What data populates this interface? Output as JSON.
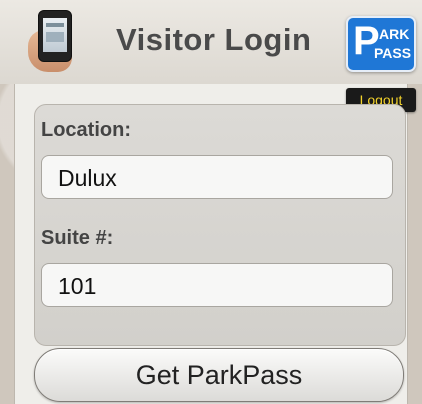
{
  "header": {
    "title": "Visitor Login",
    "logo": {
      "letter": "P",
      "line1": "ARK",
      "line2": "PASS",
      "color": "#1f77d6"
    },
    "phone_icon": "phone-in-hand-icon"
  },
  "logout_label": "Logout",
  "form": {
    "location_label": "Location:",
    "location_value": "Dulux",
    "suite_label": "Suite #:",
    "suite_value": "101"
  },
  "submit_label": "Get ParkPass",
  "colors": {
    "logout_bg": "#1a1a1a",
    "logout_text": "#f3d22b",
    "brand_blue": "#1f77d6"
  }
}
